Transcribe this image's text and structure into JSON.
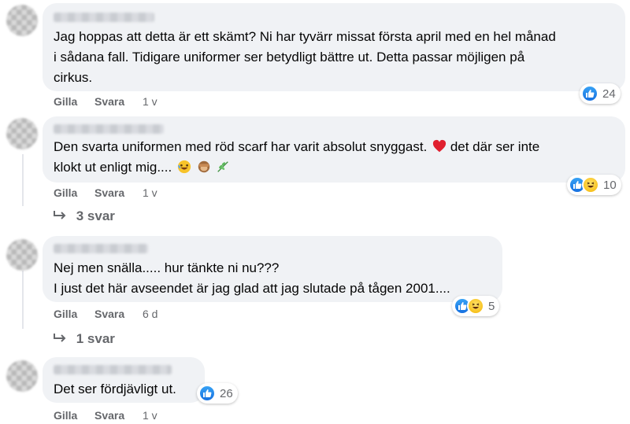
{
  "comments": [
    {
      "lines": [
        "Jag hoppas att detta är ett skämt? Ni har tyvärr missat första april med en hel månad",
        "i sådana fall. Tidigare uniformer ser betydligt bättre ut. Detta passar möjligen på",
        "cirkus."
      ],
      "like_label": "Gilla",
      "reply_label": "Svara",
      "time": "1 v",
      "reaction_count": "24",
      "reactions": [
        "like-icon"
      ]
    },
    {
      "lines": [
        "Den svarta uniformen med röd scarf har varit absolut snyggast.",
        "det där ser inte",
        "klokt ut enligt mig...."
      ],
      "like_label": "Gilla",
      "reply_label": "Svara",
      "time": "1 v",
      "reaction_count": "10",
      "reactions": [
        "like-icon",
        "haha-icon"
      ],
      "replies": "3 svar"
    },
    {
      "lines": [
        "Nej men snälla..... hur tänkte ni nu???",
        "I just det här avseendet är jag glad att jag slutade på tågen 2001...."
      ],
      "like_label": "Gilla",
      "reply_label": "Svara",
      "time": "6 d",
      "reaction_count": "5",
      "reactions": [
        "like-icon",
        "haha-icon"
      ],
      "replies": "1 svar"
    },
    {
      "lines": [
        "Det ser fördjävligt ut."
      ],
      "like_label": "Gilla",
      "reply_label": "Svara",
      "time": "1 v",
      "reaction_count": "26",
      "reactions": [
        "like-icon"
      ]
    }
  ],
  "colors": {
    "bubble": "#f0f2f5",
    "meta_text": "#65676b",
    "like_blue": "#1877f2",
    "haha_yellow": "#f7b928"
  }
}
